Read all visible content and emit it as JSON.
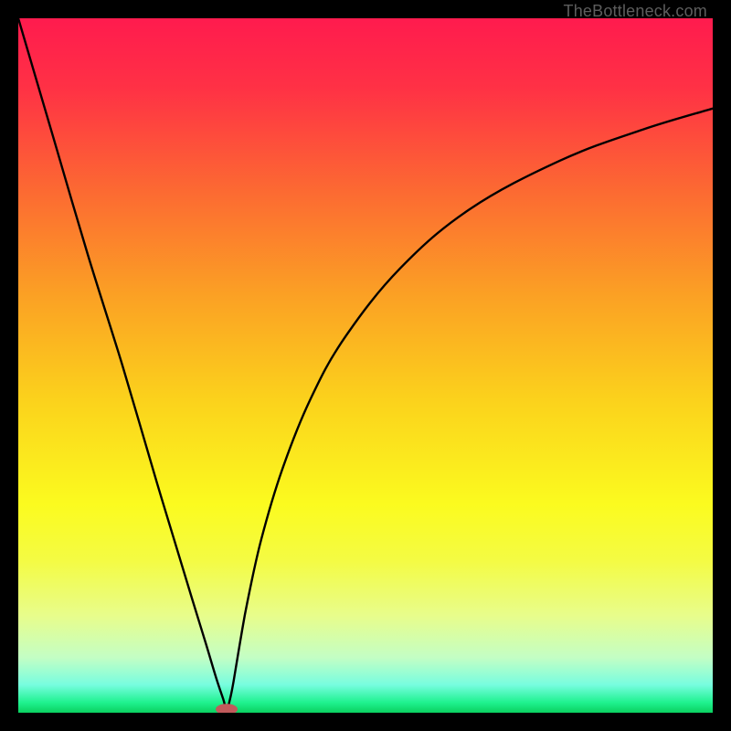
{
  "watermark": "TheBottleneck.com",
  "chart_data": {
    "type": "line",
    "title": "",
    "xlabel": "",
    "ylabel": "",
    "xlim": [
      0,
      100
    ],
    "ylim": [
      0,
      100
    ],
    "grid": false,
    "background_gradient": {
      "stops": [
        {
          "offset": 0.0,
          "color": "#ff1b4e"
        },
        {
          "offset": 0.1,
          "color": "#ff3145"
        },
        {
          "offset": 0.25,
          "color": "#fc6a32"
        },
        {
          "offset": 0.4,
          "color": "#fba124"
        },
        {
          "offset": 0.55,
          "color": "#fbd21c"
        },
        {
          "offset": 0.7,
          "color": "#fbfb1f"
        },
        {
          "offset": 0.78,
          "color": "#f4fb43"
        },
        {
          "offset": 0.86,
          "color": "#e8fd8b"
        },
        {
          "offset": 0.92,
          "color": "#c4fec4"
        },
        {
          "offset": 0.96,
          "color": "#77fddf"
        },
        {
          "offset": 0.985,
          "color": "#20f290"
        },
        {
          "offset": 1.0,
          "color": "#0ad160"
        }
      ]
    },
    "series": [
      {
        "name": "bottleneck-curve",
        "color": "#000000",
        "x": [
          0,
          5,
          10,
          15,
          20,
          25,
          27,
          28.5,
          29.5,
          30,
          30.5,
          31,
          32,
          33,
          35,
          38,
          42,
          47,
          55,
          65,
          78,
          90,
          100
        ],
        "y": [
          100,
          83,
          66,
          50,
          33,
          16.5,
          10,
          5,
          2,
          0.5,
          2,
          4.5,
          10.5,
          16,
          25,
          35,
          45,
          54,
          64,
          72.5,
          79.5,
          84,
          87
        ]
      }
    ],
    "marker": {
      "name": "optimal-point",
      "x": 30,
      "y": 0.5,
      "color": "#c15a5b"
    }
  }
}
